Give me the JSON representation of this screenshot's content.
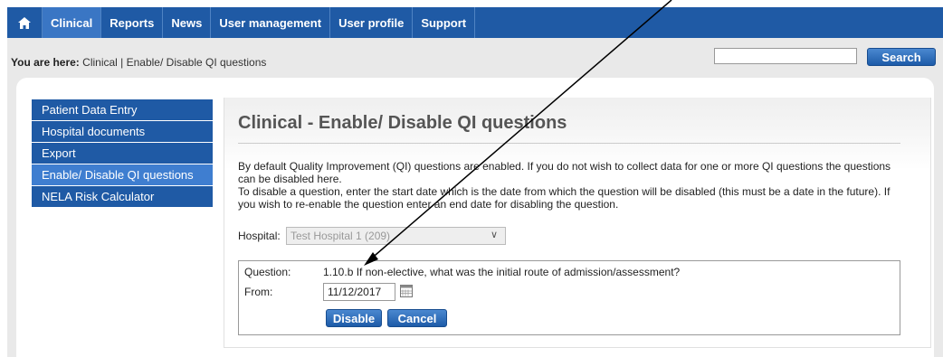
{
  "nav": {
    "home_icon": "home-icon",
    "items": [
      "Clinical",
      "Reports",
      "News",
      "User management",
      "User profile",
      "Support"
    ]
  },
  "breadcrumb": {
    "prefix": "You are here:",
    "path": "Clinical | Enable/ Disable QI questions"
  },
  "search": {
    "value": "",
    "button_label": "Search"
  },
  "sidebar": {
    "items": [
      "Patient Data Entry",
      "Hospital documents",
      "Export",
      "Enable/ Disable QI questions",
      "NELA Risk Calculator"
    ]
  },
  "main": {
    "title": "Clinical - Enable/ Disable QI questions",
    "desc1": "By default Quality Improvement (QI) questions are enabled. If you do not wish to collect data for one or more QI questions the questions can be disabled here.",
    "desc2": "To disable a question, enter the start date which is the date from which the question will be disabled (this must be a date in the future). If you wish to re-enable the question enter an end date for disabling the question.",
    "hospital_label": "Hospital:",
    "hospital_value": "Test Hospital 1 (209)",
    "question_label": "Question:",
    "question_value": "1.10.b If non-elective, what was the initial route of admission/assessment?",
    "from_label": "From:",
    "from_value": "11/12/2017",
    "disable_label": "Disable",
    "cancel_label": "Cancel"
  },
  "colors": {
    "nav_blue": "#1f5aa5",
    "active_blue": "#3a76c4",
    "panel_grey": "#e9e9e9"
  }
}
